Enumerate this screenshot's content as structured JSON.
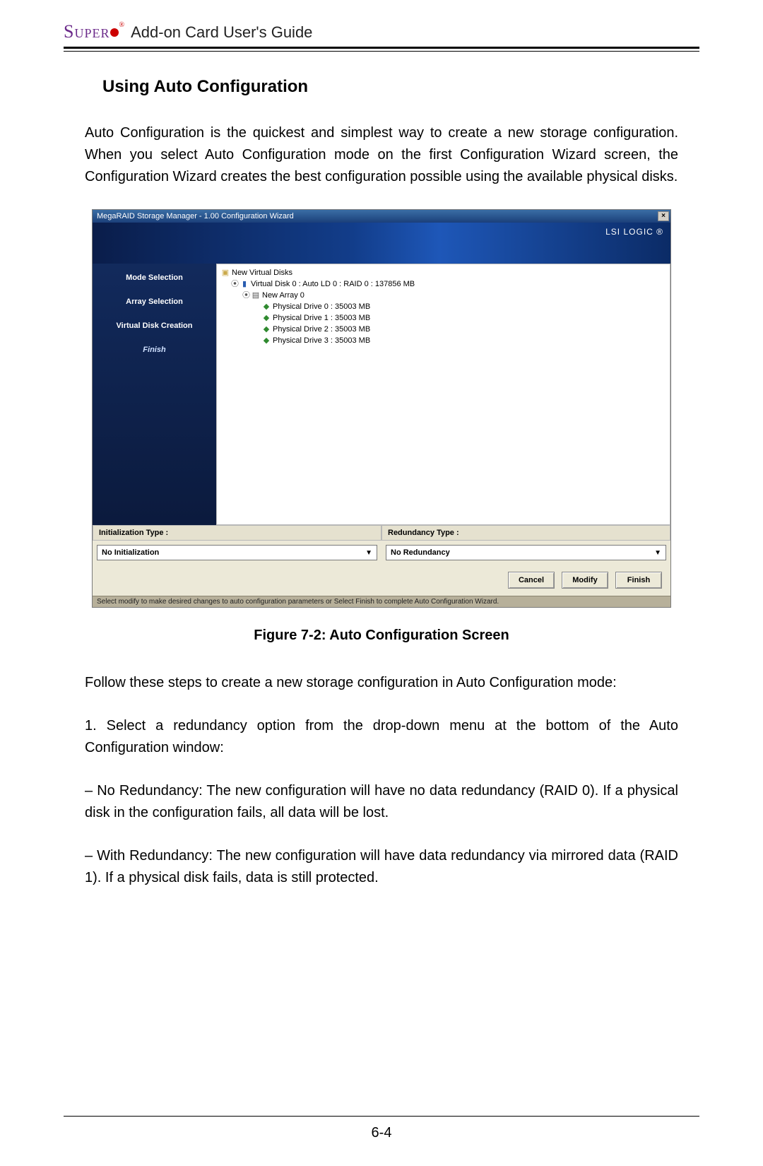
{
  "header": {
    "brand_text": "Super",
    "doc_title": "Add-on Card User's Guide"
  },
  "section_heading": "Using Auto Configuration",
  "intro_paragraph": "Auto Configuration is the quickest and simplest way to create a new storage configuration. When you select Auto Configuration mode on the first Configuration Wizard screen, the Configuration Wizard creates the best configuration possible using the available physical disks.",
  "dialog": {
    "title": "MegaRAID Storage Manager - 1.00 Configuration Wizard",
    "close_glyph": "×",
    "banner_brand": "LSI LOGIC ®",
    "sidebar_steps": [
      "Mode Selection",
      "Array Selection",
      "Virtual Disk Creation",
      "Finish"
    ],
    "sidebar_active_index": 3,
    "tree": {
      "root": "New Virtual Disks",
      "vd": "Virtual Disk 0 : Auto LD 0 : RAID 0 : 137856 MB",
      "array": "New Array 0",
      "drives": [
        "Physical Drive 0 : 35003 MB",
        "Physical Drive 1 : 35003 MB",
        "Physical Drive 2 : 35003 MB",
        "Physical Drive 3 : 35003 MB"
      ]
    },
    "options": {
      "init_label": "Initialization Type :",
      "init_value": "No Initialization",
      "red_label": "Redundancy Type :",
      "red_value": "No Redundancy"
    },
    "buttons": {
      "cancel": "Cancel",
      "modify": "Modify",
      "finish": "Finish"
    },
    "status": "Select modify to make desired changes to auto configuration parameters or Select Finish to complete Auto Configuration Wizard."
  },
  "figure_caption": "Figure 7-2: Auto Configuration Screen",
  "after_figure_paragraph": "Follow these steps to create a new storage configuration in Auto Configuration mode:",
  "step1_paragraph": "1. Select a redundancy option from the drop-down menu at the bottom of the Auto Configuration window:",
  "bullet_no_red": "– No Redundancy: The new configuration will have no data redundancy (RAID 0). If a physical disk in the configuration fails, all data will be lost.",
  "bullet_with_red": "– With Redundancy: The new configuration will have data redundancy via mirrored data (RAID 1). If a physical disk fails, data is still protected.",
  "page_number": "6-4"
}
